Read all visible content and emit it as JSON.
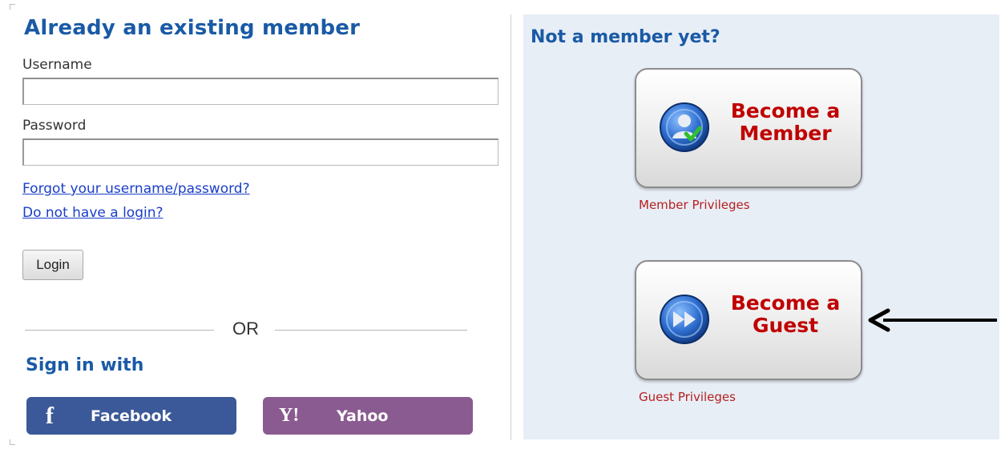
{
  "login": {
    "title": "Already an existing member",
    "username_label": "Username",
    "username_value": "",
    "password_label": "Password",
    "password_value": "",
    "forgot_link": "Forgot your username/password?",
    "no_login_link": "Do not have a login?",
    "login_button": "Login",
    "or_text": "OR",
    "signin_title": "Sign in with",
    "facebook_label": "Facebook",
    "yahoo_label": "Yahoo",
    "facebook_icon": "f",
    "yahoo_icon": "Y!"
  },
  "register": {
    "title": "Not a member yet?",
    "member_line1": "Become a",
    "member_line2": "Member",
    "member_privileges": "Member Privileges",
    "guest_line1": "Become a",
    "guest_line2": "Guest",
    "guest_privileges": "Guest Privileges"
  },
  "colors": {
    "heading_blue": "#1a5aa5",
    "link_blue": "#1a3ec8",
    "cta_red": "#c00000",
    "facebook": "#3b5998",
    "yahoo": "#8a5b90",
    "panel_bg": "#e8eef6"
  },
  "icons": {
    "member_icon": "user-check-icon",
    "guest_icon": "fast-forward-icon",
    "annotation": "left-arrow-icon"
  }
}
